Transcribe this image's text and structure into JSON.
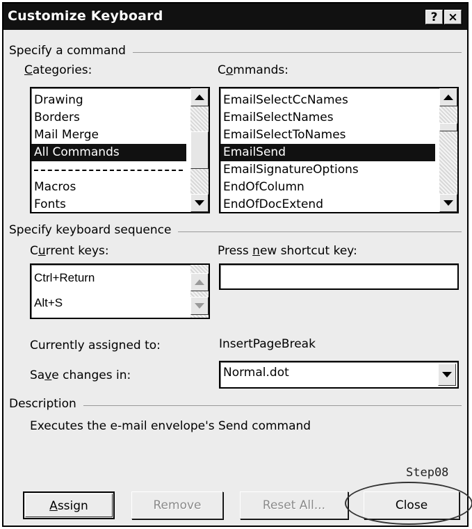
{
  "window": {
    "title": "Customize Keyboard",
    "help_button": "?",
    "close_button": "×"
  },
  "specify_command": {
    "group_label": "Specify a command",
    "categories_label": "Categories:",
    "commands_label": "Commands:",
    "categories": [
      "Drawing",
      "Borders",
      "Mail Merge",
      "All Commands",
      "---",
      "Macros",
      "Fonts"
    ],
    "selected_category": "All Commands",
    "commands": [
      "EmailSelectCcNames",
      "EmailSelectNames",
      "EmailSelectToNames",
      "EmailSend",
      "EmailSignatureOptions",
      "EndOfColumn",
      "EndOfDocExtend"
    ],
    "selected_command": "EmailSend"
  },
  "keyboard_sequence": {
    "group_label": "Specify keyboard sequence",
    "current_keys_label": "Current keys:",
    "current_keys": [
      "Ctrl+Return",
      "Alt+S"
    ],
    "new_shortcut_label": "Press new shortcut key:",
    "new_shortcut_value": "",
    "assigned_label": "Currently assigned to:",
    "assigned_value": "InsertPageBreak",
    "save_in_label": "Save changes in:",
    "save_in_value": "Normal.dot"
  },
  "description": {
    "group_label": "Description",
    "text": "Executes the e-mail envelope's Send command"
  },
  "buttons": {
    "assign": "Assign",
    "remove": "Remove",
    "reset_all": "Reset All...",
    "close": "Close"
  },
  "annotation": {
    "step_label": "Step08"
  },
  "colors": {
    "titlebar": "#111111",
    "dialog_bg": "#ececec",
    "selection": "#111111"
  }
}
